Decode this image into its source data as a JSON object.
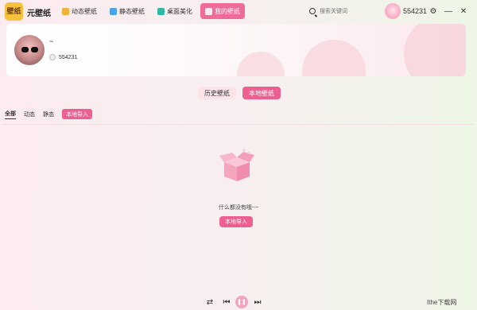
{
  "app": {
    "logo_text": "壁纸",
    "name": "元壁纸"
  },
  "nav": [
    {
      "label": "动态壁纸",
      "icon": "video-icon",
      "color": "#f1b238",
      "active": false
    },
    {
      "label": "静态壁纸",
      "icon": "image-icon",
      "color": "#4aa3e8",
      "active": false
    },
    {
      "label": "桌面美化",
      "icon": "monitor-icon",
      "color": "#2fb8a4",
      "active": false
    },
    {
      "label": "我的壁纸",
      "icon": "user-icon",
      "color": "#ffffff",
      "active": true
    }
  ],
  "search": {
    "placeholder": "搜索关键词"
  },
  "user": {
    "name": "554231"
  },
  "profile": {
    "nickname": "~",
    "id": "554231"
  },
  "main_tabs": [
    {
      "label": "历史壁纸",
      "active": false
    },
    {
      "label": "本地壁纸",
      "active": true
    }
  ],
  "filters": [
    {
      "label": "全部",
      "selected": true
    },
    {
      "label": "动态",
      "selected": false
    },
    {
      "label": "静态",
      "selected": false
    }
  ],
  "filter_button": "本地导入",
  "empty": {
    "message": "什么都没有哦~~",
    "button": "本地导入"
  },
  "watermark": "Ithe下载网",
  "colors": {
    "accent": "#ee5f91",
    "logo_bg": "#f6c13b"
  }
}
